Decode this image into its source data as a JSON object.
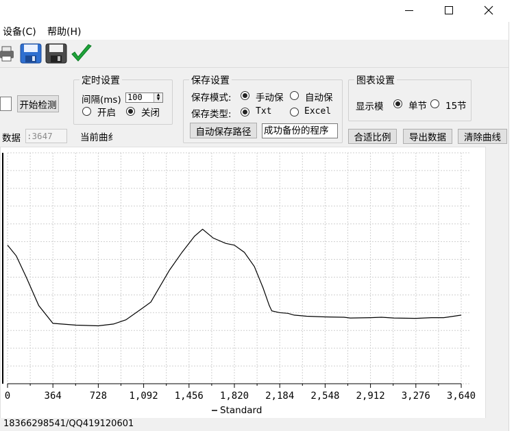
{
  "window": {
    "minimize_glyph": "—",
    "maximize_glyph": "□",
    "close_glyph": "✕"
  },
  "menu": {
    "items": [
      {
        "label": "设备(C)"
      },
      {
        "label": "帮助(H)"
      }
    ]
  },
  "toolbar": {
    "icons": [
      "printer-icon",
      "save-icon",
      "save-as-icon",
      "checkmark-icon"
    ]
  },
  "detect": {
    "button": "开始检测",
    "data_label": "数据",
    "data_value": ":3647"
  },
  "timer": {
    "title": "定时设置",
    "interval_label": "间隔(ms)",
    "interval_value": "100",
    "on_label": "开启",
    "off_label": "关闭",
    "selected": "off"
  },
  "current_curve": {
    "label": "当前曲纟"
  },
  "save": {
    "title": "保存设置",
    "mode_label": "保存模式:",
    "mode_manual": "手动保",
    "mode_auto": "自动保",
    "type_label": "保存类型:",
    "type_txt": "Txt",
    "type_excel": "Excel",
    "auto_path_button": "自动保存路径",
    "status_text": "成功备份的程序"
  },
  "chart_settings": {
    "title": "图表设置",
    "display_label": "显示模",
    "single_label": "单节",
    "fifteen_label": "15节"
  },
  "actions": {
    "fit_button": "合适比例",
    "export_button": "导出数据",
    "clear_button": "清除曲线"
  },
  "status_bar": {
    "text": "18366298541/QQ419120601"
  },
  "chart_data": {
    "type": "line",
    "title": "",
    "xlabel": "",
    "ylabel": "",
    "legend": {
      "entries": [
        "Standard"
      ],
      "placement": "bottom-center"
    },
    "xlim": [
      0,
      3640
    ],
    "x_ticks": [
      "0",
      "364",
      "728",
      "1,092",
      "1,456",
      "1,820",
      "2,184",
      "2,548",
      "2,912",
      "3,276",
      "3,640"
    ],
    "grid": true,
    "series": [
      {
        "name": "Standard",
        "color": "#000000",
        "x": [
          0,
          70,
          150,
          250,
          364,
          550,
          728,
          850,
          950,
          1092,
          1150,
          1200,
          1300,
          1400,
          1500,
          1565,
          1650,
          1750,
          1820,
          1900,
          1980,
          2050,
          2100,
          2120,
          2184,
          2250,
          2300,
          2400,
          2548,
          2700,
          2750,
          2912,
          3000,
          3100,
          3276,
          3400,
          3500,
          3640
        ],
        "y": [
          59,
          56,
          50,
          42,
          37,
          36.5,
          36.3,
          36.8,
          38,
          41.5,
          43,
          46,
          52,
          57,
          61.5,
          63.5,
          61,
          59.5,
          59,
          57,
          53,
          47,
          42,
          40.5,
          40,
          39.8,
          39.3,
          39,
          38.8,
          38.7,
          38.5,
          38.6,
          38.7,
          38.5,
          38.4,
          38.6,
          38.6,
          39.3
        ]
      }
    ]
  }
}
